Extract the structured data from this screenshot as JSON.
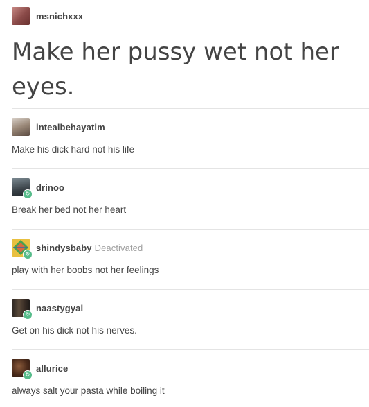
{
  "original_post": {
    "username": "msnichxxx",
    "text": "Make her pussy wet not her eyes."
  },
  "replies": [
    {
      "username": "intealbehayatim",
      "text": "Make his dick hard not his life",
      "reblogged": false,
      "deactivated_label": ""
    },
    {
      "username": "drinoo",
      "text": "Break her bed not her heart",
      "reblogged": true,
      "deactivated_label": ""
    },
    {
      "username": "shindysbaby",
      "text": "play with her boobs not her feelings",
      "reblogged": true,
      "deactivated_label": "Deactivated"
    },
    {
      "username": "naastygyal",
      "text": "Get on his dick not his nerves.",
      "reblogged": true,
      "deactivated_label": ""
    },
    {
      "username": "allurice",
      "text": "always salt your pasta while boiling it",
      "reblogged": true,
      "deactivated_label": ""
    }
  ],
  "icons": {
    "reblog": "reblog-icon"
  },
  "colors": {
    "text": "#444444",
    "reblog_badge": "#56bc8a",
    "deactivated": "#a0a0a0",
    "divider": "#e4e4e4"
  }
}
